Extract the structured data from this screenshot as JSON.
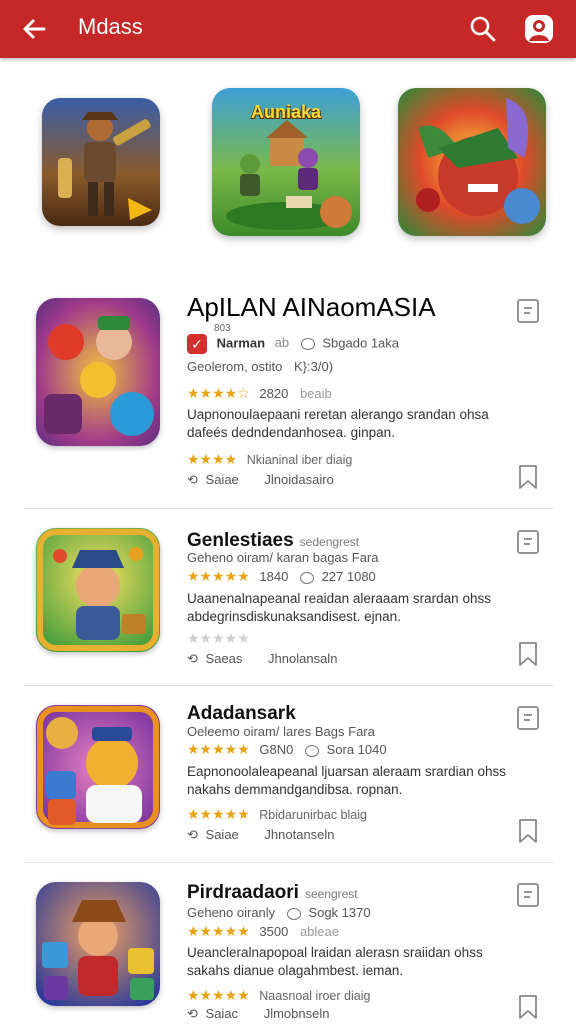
{
  "appbar": {
    "title": "Mdass"
  },
  "featured": [
    {
      "caption": ""
    },
    {
      "caption": "Auniaka"
    },
    {
      "caption": ""
    }
  ],
  "items": [
    {
      "name": "ApILAN AINaomASIA",
      "dev_small": "803",
      "developer": "Narman",
      "developer_note": "ab",
      "downloads": "Sbgado 1aka",
      "genre_line": "Geolerom, ostito",
      "genre_extra": "K}:3/0)",
      "rating": "2820",
      "rating_note": "beaib",
      "desc": "Uapnonoulaepaani reretan alerango srandan ohsa dafeés dedndendanhosea. ginpan.",
      "tag": "Nkianinal iber diaig",
      "footer_a": "Saiae",
      "footer_b": "Jlnoidasairo"
    },
    {
      "name": "Genlestiaes",
      "name_suffix": "sedengrest",
      "meta_line": "Geheno oiram/ karan bagas Fara",
      "rating": "1840",
      "reviews": "227 1080",
      "desc": "Uaanenalnapeanal reaidan aleraaam srardan ohss abdegrinsdiskunaksandisest. ejnan.",
      "footer_a": "Saeas",
      "footer_b": "Jhnolansaln"
    },
    {
      "name": "Adadansark",
      "meta_line": "Oeleemo oiram/ lares Bags Fara",
      "rating": "G8N0",
      "reviews": "Sora 1040",
      "desc": "Eapnonoolaleapeanal ljuarsan aleraam srardian ohss nakahs demmandgandibsa. ropnan.",
      "tag": "Rbidarunirbac blaig",
      "footer_a": "Saiae",
      "footer_b": "Jhnotanseln"
    },
    {
      "name": "Pirdraadaori",
      "name_suffix": "seengrest",
      "meta_line": "Geheno oiranly",
      "reviews": "Sogk 1370",
      "rating": "3500",
      "rating_note": "ableae",
      "desc": "Ueancleralnapopoal lraidan alerasn sraiidan ohss sakahs dianue olagahmbest. ieman.",
      "tag": "Naasnoal iroer diaig",
      "footer_a": "Saiac",
      "footer_b": "Jlmobnseln"
    }
  ],
  "colors": {
    "appbar": "#c62828",
    "star": "#e8a317",
    "check": "#d32f2f"
  }
}
